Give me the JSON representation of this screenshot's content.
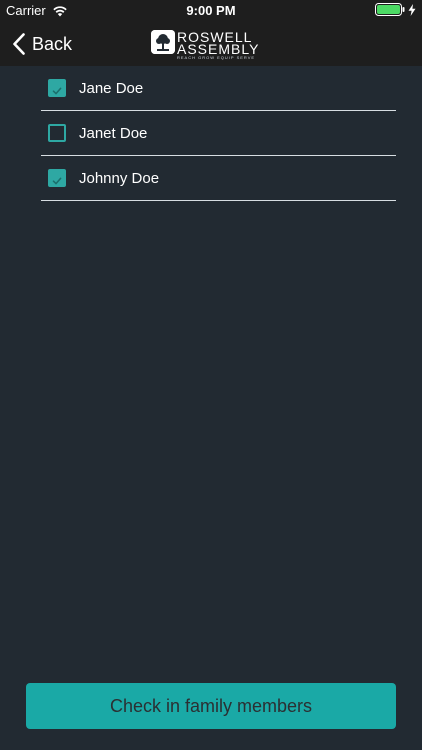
{
  "status_bar": {
    "carrier": "Carrier",
    "time": "9:00 PM"
  },
  "nav": {
    "back_label": "Back",
    "logo": {
      "text_top": "ROSWELL",
      "text_bottom": "ASSEMBLY",
      "tagline": "REACH   GROW   EQUIP   SERVE"
    }
  },
  "members": [
    {
      "name": "Jane Doe",
      "checked": true
    },
    {
      "name": "Janet Doe",
      "checked": false
    },
    {
      "name": "Johnny Doe",
      "checked": true
    }
  ],
  "cta": {
    "label": "Check in family members"
  },
  "colors": {
    "background": "#222a32",
    "topbar": "#1e1e1e",
    "accent": "#1aa9a6",
    "divider": "#d7dde2"
  },
  "icons": {
    "wifi": "wifi-icon",
    "battery": "battery-icon",
    "charging": "bolt-icon",
    "back": "chevron-left-icon",
    "check": "checkmark-icon"
  }
}
